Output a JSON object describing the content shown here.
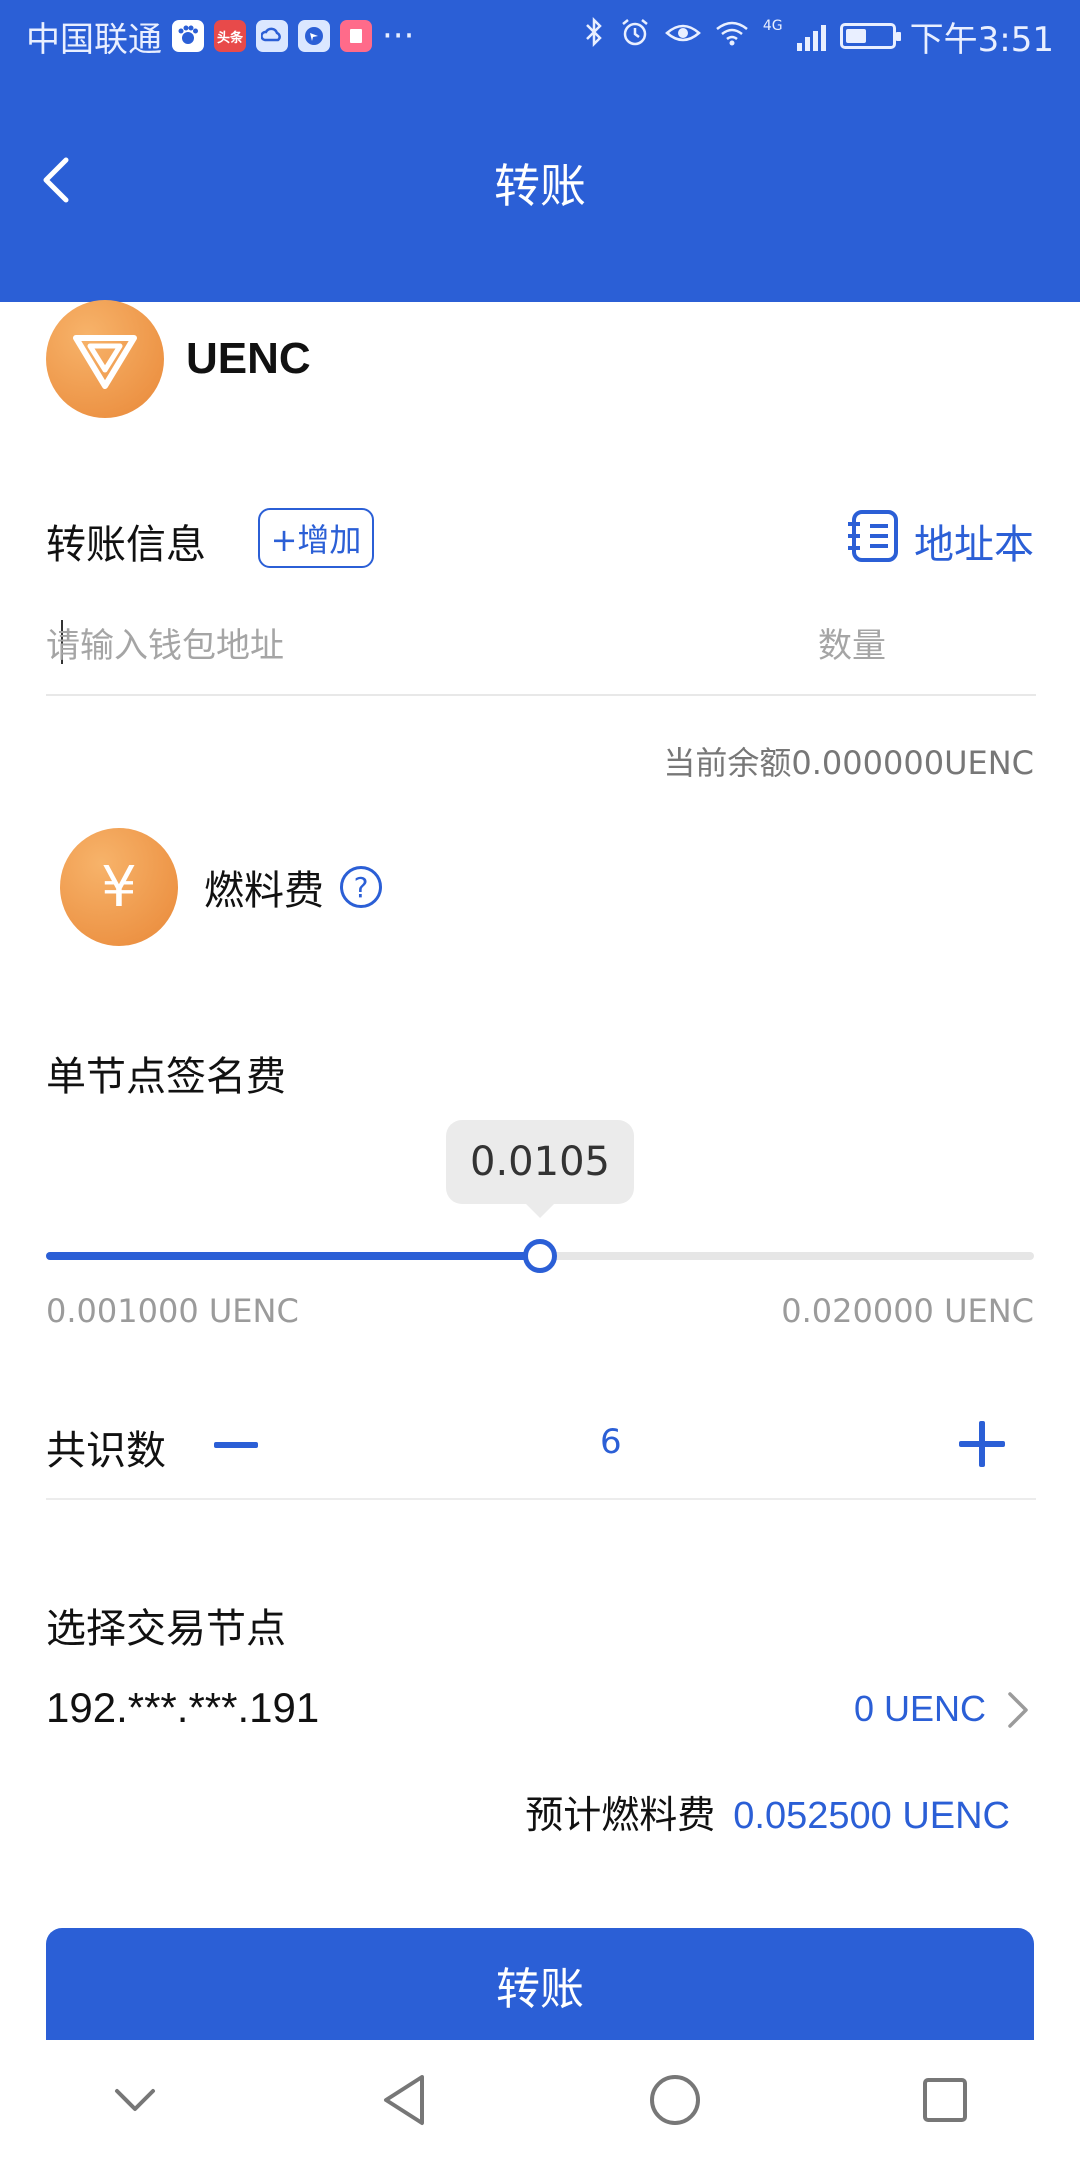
{
  "status_bar": {
    "carrier": "中国联通",
    "app_icons": [
      "baidu-app-icon",
      "toutiao-app-icon",
      "cloud-app-icon",
      "browser-app-icon",
      "reader-app-icon"
    ],
    "toutiao_label": "头条",
    "more": "···",
    "time": "下午3:51",
    "network": "4G",
    "battery_level": 0.45
  },
  "header": {
    "title": "转账",
    "background": "#2b5fd6"
  },
  "coin": {
    "name": "UENC"
  },
  "transfer": {
    "section_label": "转账信息",
    "add_label": "+增加",
    "address_book_label": "地址本",
    "address_placeholder": "请输入钱包地址",
    "quantity_placeholder": "数量",
    "balance_text": "当前余额0.000000UENC"
  },
  "fee": {
    "label": "燃料费",
    "coin_symbol": "¥",
    "help": "?"
  },
  "signature_fee": {
    "label": "单节点签名费",
    "value": "0.0105",
    "min_label": "0.001000 UENC",
    "max_label": "0.020000 UENC",
    "level": 0.5
  },
  "consensus": {
    "label": "共识数",
    "value": "6"
  },
  "node": {
    "label": "选择交易节点",
    "ip": "192.***.***.191",
    "balance": "0 UENC"
  },
  "estimate": {
    "label": "预计燃料费",
    "value": "0.052500 UENC"
  },
  "submit": {
    "label": "转账"
  },
  "colors": {
    "accent": "#2b5fd6",
    "coin_orange": "#e98838"
  }
}
